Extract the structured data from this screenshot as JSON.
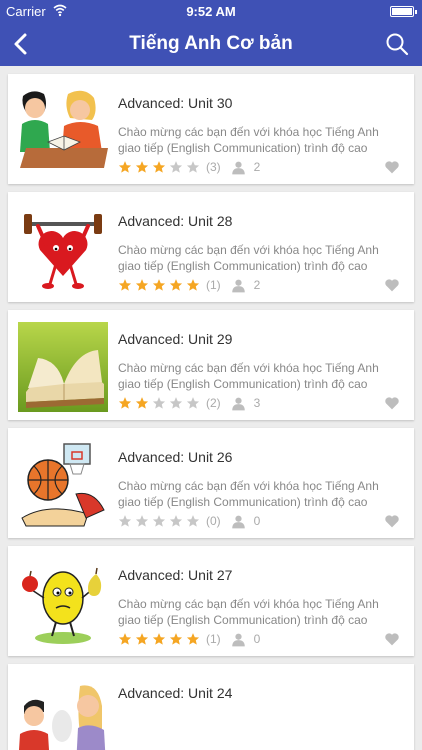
{
  "status_bar": {
    "carrier": "Carrier",
    "time": "9:52 AM"
  },
  "nav": {
    "title": "Tiếng Anh Cơ bản"
  },
  "colors": {
    "primary": "#3f51b5",
    "star_on": "#f5a623",
    "star_off": "#c7c7c7",
    "icon_grey": "#bdbdbd"
  },
  "units": [
    {
      "title": "Advanced: Unit 30",
      "description": "Chào mừng các bạn đến với khóa học Tiếng Anh giao tiếp (English Communication) trình độ cao",
      "rating": 3,
      "rating_count": "(3)",
      "learners": "2",
      "thumbnail": "students-reading-illustration"
    },
    {
      "title": "Advanced: Unit 28",
      "description": "Chào mừng các bạn đến với khóa học Tiếng Anh giao tiếp (English Communication) trình độ cao",
      "rating": 5,
      "rating_count": "(1)",
      "learners": "2",
      "thumbnail": "heart-lifting-barbell-illustration"
    },
    {
      "title": "Advanced: Unit 29",
      "description": "Chào mừng các bạn đến với khóa học Tiếng Anh giao tiếp (English Communication) trình độ cao",
      "rating": 2,
      "rating_count": "(2)",
      "learners": "3",
      "thumbnail": "open-book-photo"
    },
    {
      "title": "Advanced: Unit 26",
      "description": "Chào mừng các bạn đến với khóa học Tiếng Anh giao tiếp (English Communication) trình độ cao",
      "rating": 0,
      "rating_count": "(0)",
      "learners": "0",
      "thumbnail": "basketball-hoop-illustration"
    },
    {
      "title": "Advanced: Unit 27",
      "description": "Chào mừng các bạn đến với khóa học Tiếng Anh giao tiếp (English Communication) trình độ cao",
      "rating": 5,
      "rating_count": "(1)",
      "learners": "0",
      "thumbnail": "lemon-with-apple-and-pear-illustration"
    },
    {
      "title": "Advanced: Unit 24",
      "description": "",
      "rating": 0,
      "rating_count": "",
      "learners": "",
      "thumbnail": "people-talking-english-illustration"
    }
  ]
}
